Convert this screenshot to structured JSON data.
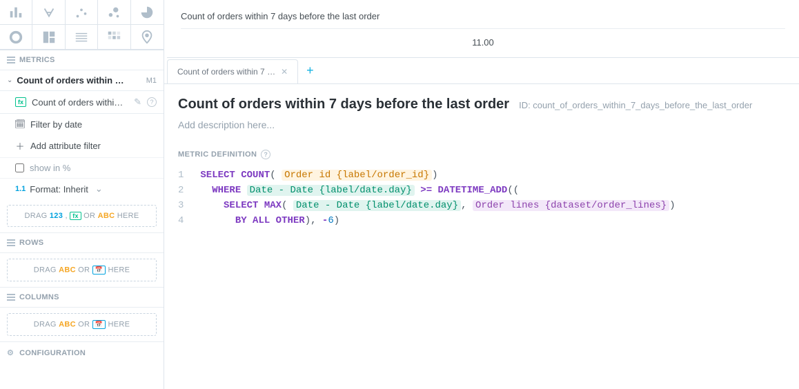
{
  "chart_types": [
    {
      "name": "column-chart-icon"
    },
    {
      "name": "headline-icon"
    },
    {
      "name": "scatter-icon"
    },
    {
      "name": "bubble-icon"
    },
    {
      "name": "pie-icon"
    },
    {
      "name": "donut-icon"
    },
    {
      "name": "treemap-icon"
    },
    {
      "name": "table-icon"
    },
    {
      "name": "heatmap-icon"
    },
    {
      "name": "geo-icon"
    }
  ],
  "sidebar": {
    "metrics_label": "METRICS",
    "metric": {
      "title": "Count of orders within …",
      "tag": "M1",
      "sub_label": "Count of orders withi…",
      "fx": "fx"
    },
    "filter_date": "Filter by date",
    "add_attr": "Add attribute filter",
    "show_pct": "show in %",
    "format_icon": "1.1",
    "format_label": "Format: Inherit",
    "drop_metrics_pre": "DRAG ",
    "drop_metrics_num": "123",
    "drop_metrics_mid1": " , ",
    "drop_metrics_fx": "fx",
    "drop_metrics_mid2": " OR ",
    "drop_metrics_abc": "ABC",
    "drop_post": " HERE",
    "rows_label": "ROWS",
    "cols_label": "COLUMNS",
    "drop_rc_pre": "DRAG ",
    "drop_rc_abc": "ABC",
    "drop_rc_mid": " OR ",
    "drop_rc_cal": "📅",
    "config_label": "CONFIGURATION"
  },
  "preview": {
    "title": "Count of orders within 7 days before the last order",
    "value": "11.00"
  },
  "tabs": [
    {
      "label": "Count of orders within 7 …"
    }
  ],
  "editor": {
    "title": "Count of orders within 7 days before the last order",
    "id_label": "ID: count_of_orders_within_7_days_before_the_last_order",
    "desc_placeholder": "Add description here...",
    "def_label": "METRIC DEFINITION"
  },
  "code": {
    "kw_select1": "SELECT",
    "kw_count": "COUNT",
    "tok_orderid": "Order id {label/order_id}",
    "kw_where": "WHERE",
    "tok_date1": "Date - Date {label/date.day}",
    "op_gte": ">=",
    "kw_datetimeadd": "DATETIME_ADD",
    "kw_select2": "SELECT",
    "kw_max": "MAX",
    "tok_date2": "Date - Date {label/date.day}",
    "tok_orderlines": "Order lines {dataset/order_lines}",
    "kw_by": "BY",
    "kw_all": "ALL",
    "kw_other": "OTHER",
    "num_neg6": "6",
    "neg": "-"
  }
}
